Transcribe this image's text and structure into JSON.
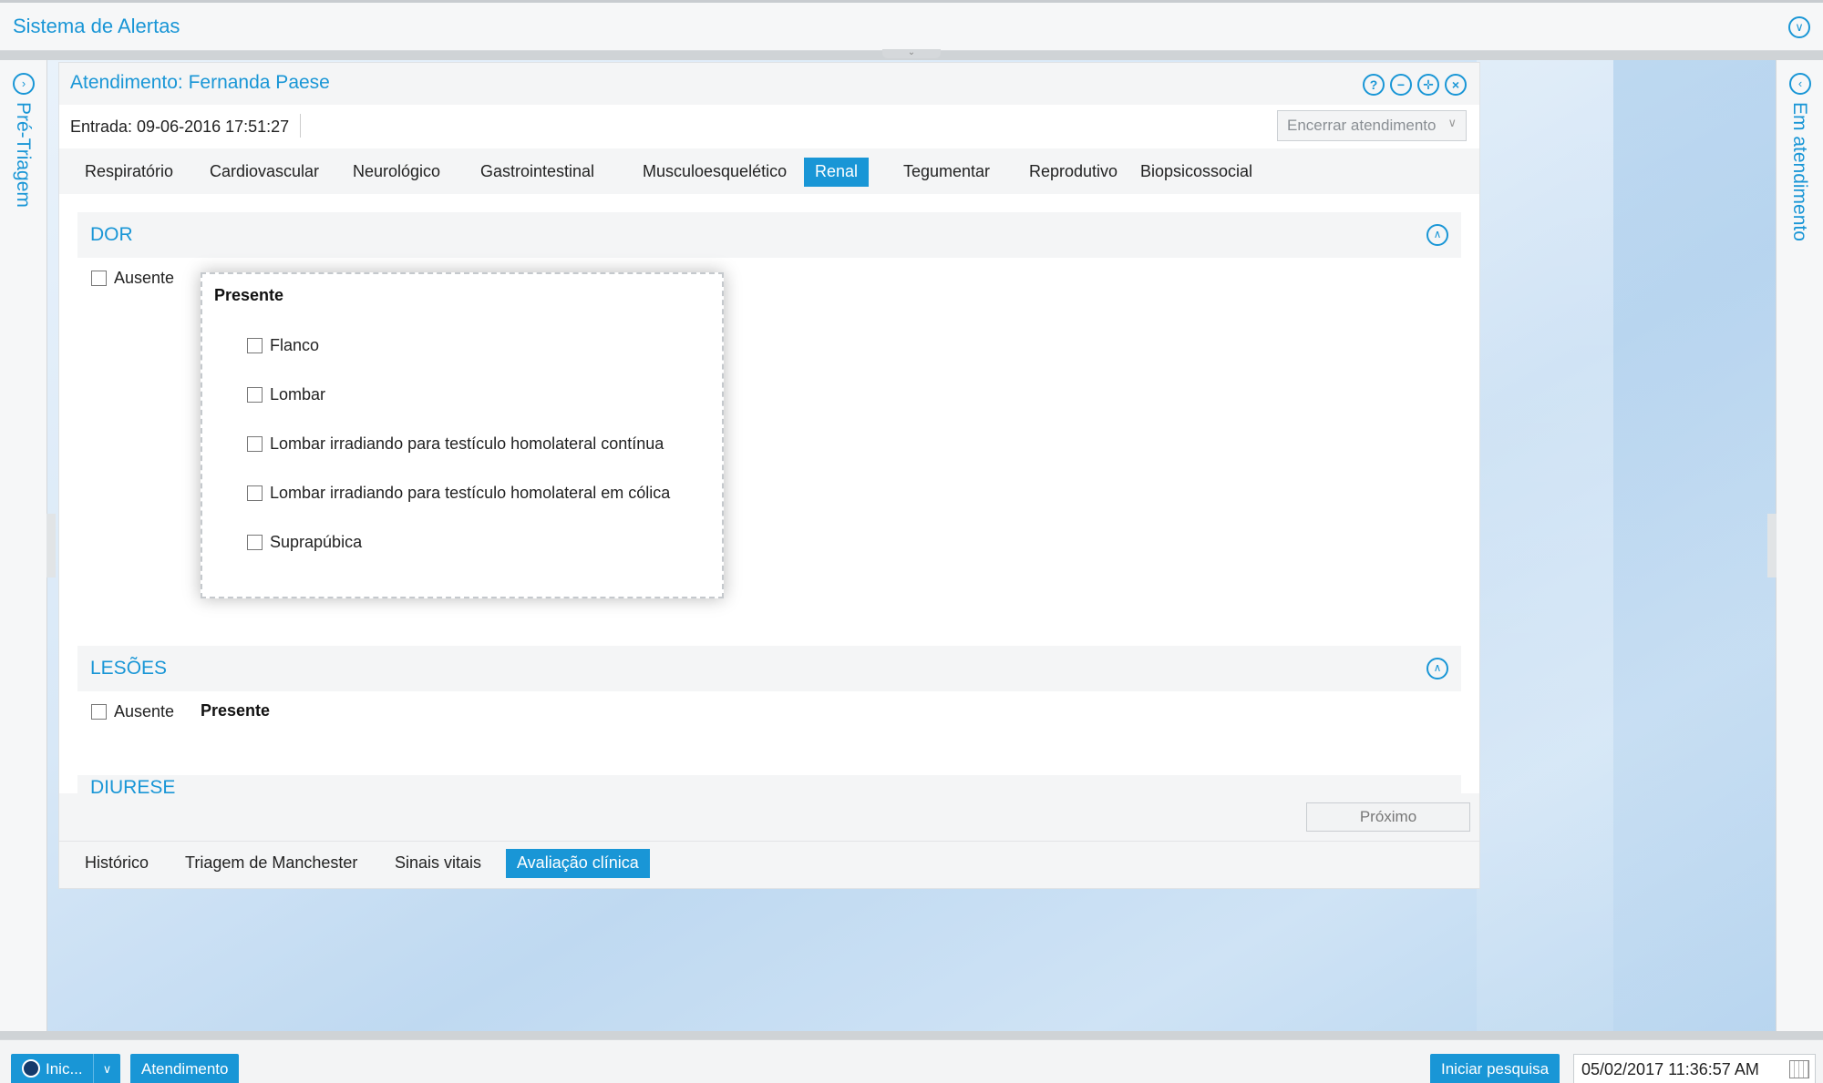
{
  "app": {
    "title": "Sistema de Alertas"
  },
  "left_panel": {
    "label": "Pré-Triagem"
  },
  "right_panel": {
    "label": "Em atendimento"
  },
  "window": {
    "title": "Atendimento: Fernanda Paese",
    "entrada": "Entrada: 09-06-2016 17:51:27",
    "encerrar_label": "Encerrar atendimento",
    "controls": [
      "help-icon",
      "minimize-icon",
      "move-icon",
      "close-icon"
    ]
  },
  "category_tabs": [
    {
      "label": "Respiratório",
      "active": false
    },
    {
      "label": "Cardiovascular",
      "active": false
    },
    {
      "label": "Neurológico",
      "active": false
    },
    {
      "label": "Gastrointestinal",
      "active": false
    },
    {
      "label": "Musculoesquelético",
      "active": false
    },
    {
      "label": "Renal",
      "active": true
    },
    {
      "label": "Tegumentar",
      "active": false
    },
    {
      "label": "Reprodutivo",
      "active": false
    },
    {
      "label": "Biopsicossocial",
      "active": false
    }
  ],
  "sections": {
    "dor": {
      "title": "DOR",
      "ausente": "Ausente",
      "presente": "Presente",
      "options": [
        "Flanco",
        "Lombar",
        "Lombar irradiando para testículo homolateral contínua",
        "Lombar irradiando para testículo homolateral em cólica",
        "Suprapúbica"
      ]
    },
    "lesoes": {
      "title": "LESÕES",
      "ausente": "Ausente",
      "presente": "Presente"
    },
    "diurese": {
      "title": "DIURESE"
    }
  },
  "proximo_label": "Próximo",
  "bottom_tabs": [
    {
      "label": "Histórico",
      "active": false
    },
    {
      "label": "Triagem de Manchester",
      "active": false
    },
    {
      "label": "Sinais vitais",
      "active": false
    },
    {
      "label": "Avaliação clínica",
      "active": true
    }
  ],
  "taskbar": {
    "inic_label": "Inic...",
    "atendimento_label": "Atendimento",
    "iniciar_pesquisa_label": "Iniciar pesquisa",
    "datetime": "05/02/2017 11:36:57 AM"
  },
  "colors": {
    "accent": "#1996d6",
    "panel_bg": "#f4f5f6"
  }
}
